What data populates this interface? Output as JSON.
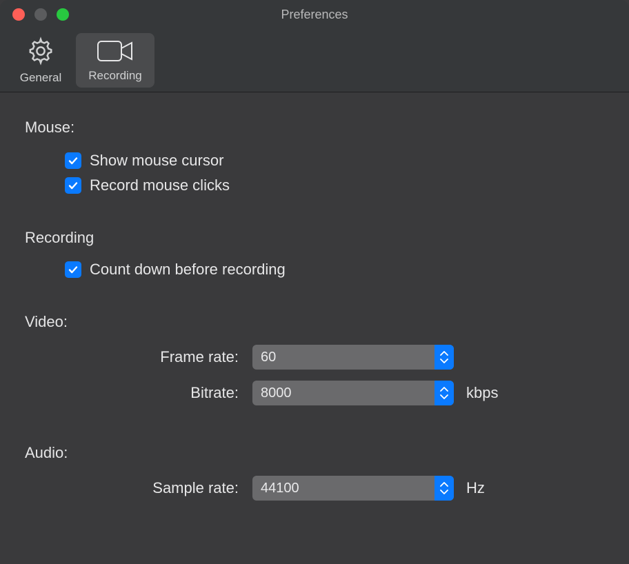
{
  "window": {
    "title": "Preferences"
  },
  "tabs": {
    "general": "General",
    "recording": "Recording"
  },
  "sections": {
    "mouse": {
      "title": "Mouse:",
      "show_cursor": "Show mouse cursor",
      "record_clicks": "Record mouse clicks"
    },
    "recording": {
      "title": "Recording",
      "countdown": "Count down before recording"
    },
    "video": {
      "title": "Video:",
      "frame_rate_label": "Frame rate:",
      "frame_rate_value": "60",
      "bitrate_label": "Bitrate:",
      "bitrate_value": "8000",
      "bitrate_unit": "kbps"
    },
    "audio": {
      "title": "Audio:",
      "sample_rate_label": "Sample rate:",
      "sample_rate_value": "44100",
      "sample_rate_unit": "Hz"
    }
  }
}
